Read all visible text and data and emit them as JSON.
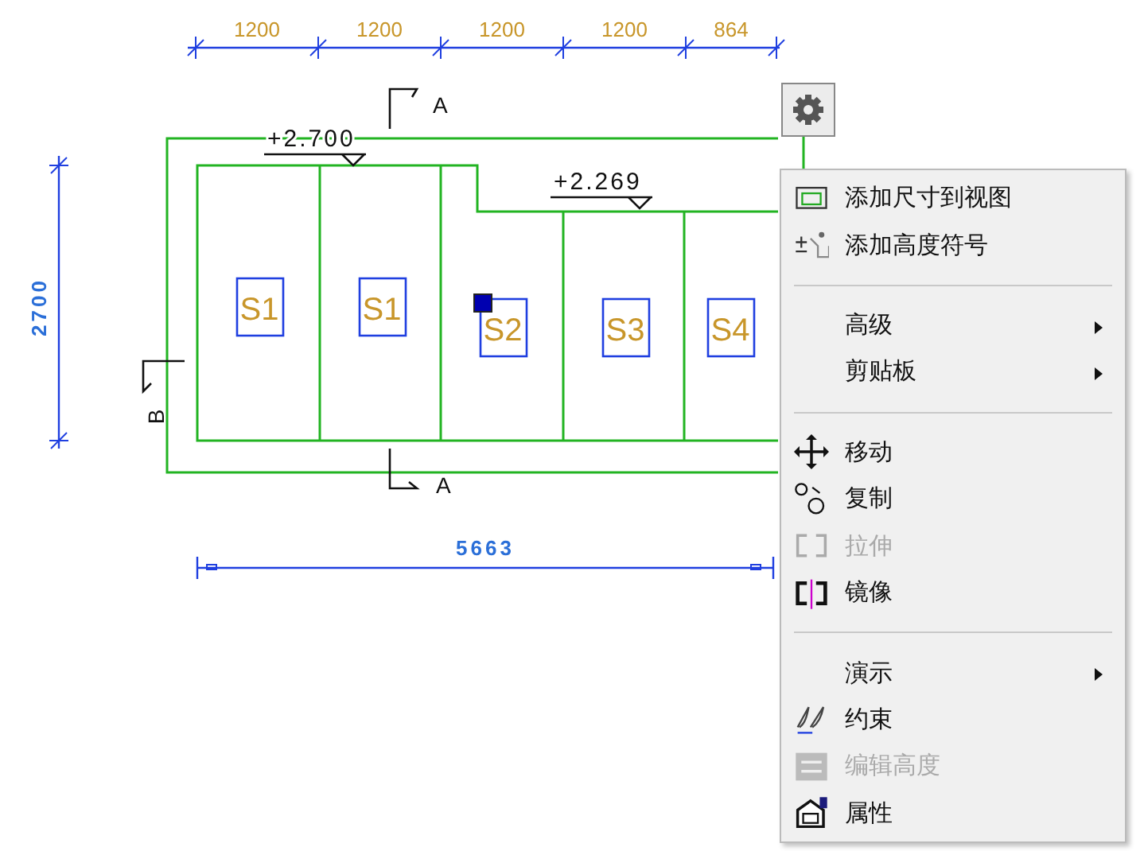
{
  "drawing": {
    "top_dimensions": [
      "1200",
      "1200",
      "1200",
      "1200",
      "864"
    ],
    "left_dimension": "2700",
    "bottom_dimension": "5663",
    "elevations": [
      "+2.700",
      "+2.269"
    ],
    "section_marks": [
      {
        "label": "A",
        "kind": "top"
      },
      {
        "label": "A",
        "kind": "bottom"
      },
      {
        "label": "B",
        "kind": "side"
      }
    ],
    "rooms": [
      {
        "label": "S1",
        "selected": false
      },
      {
        "label": "S1",
        "selected": false
      },
      {
        "label": "S2",
        "selected": true
      },
      {
        "label": "S3",
        "selected": false
      },
      {
        "label": "S4",
        "selected": false
      }
    ]
  },
  "context_menu": {
    "items": [
      {
        "kind": "item",
        "label": "添加尺寸到视图",
        "disabled": false,
        "submenu": false
      },
      {
        "kind": "item",
        "label": "添加高度符号",
        "disabled": false,
        "submenu": false
      },
      {
        "kind": "separator"
      },
      {
        "kind": "item",
        "label": "高级",
        "disabled": false,
        "submenu": true
      },
      {
        "kind": "item",
        "label": "剪贴板",
        "disabled": false,
        "submenu": true
      },
      {
        "kind": "separator"
      },
      {
        "kind": "item",
        "label": "移动",
        "disabled": false,
        "submenu": false
      },
      {
        "kind": "item",
        "label": "复制",
        "disabled": false,
        "submenu": false
      },
      {
        "kind": "item",
        "label": "拉伸",
        "disabled": true,
        "submenu": false
      },
      {
        "kind": "item",
        "label": "镜像",
        "disabled": false,
        "submenu": false
      },
      {
        "kind": "separator"
      },
      {
        "kind": "item",
        "label": "演示",
        "disabled": false,
        "submenu": true
      },
      {
        "kind": "item",
        "label": "约束",
        "disabled": false,
        "submenu": false
      },
      {
        "kind": "item",
        "label": "编辑高度",
        "disabled": true,
        "submenu": false
      },
      {
        "kind": "item",
        "label": "属性",
        "disabled": false,
        "submenu": false
      }
    ]
  }
}
